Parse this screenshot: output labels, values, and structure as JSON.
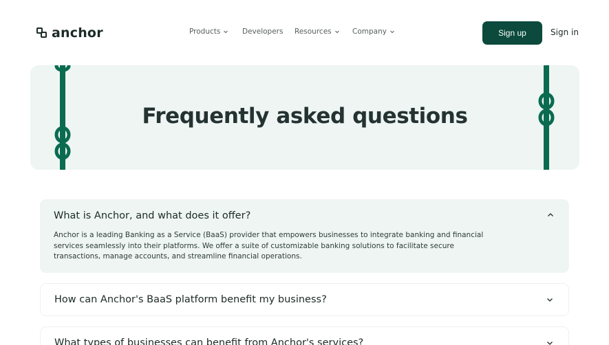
{
  "brand": {
    "name": "anchor"
  },
  "nav": {
    "items": [
      {
        "label": "Products",
        "has_dropdown": true
      },
      {
        "label": "Developers",
        "has_dropdown": false
      },
      {
        "label": "Resources",
        "has_dropdown": true
      },
      {
        "label": "Company",
        "has_dropdown": true
      }
    ],
    "signup_label": "Sign up",
    "signin_label": "Sign in"
  },
  "hero": {
    "title": "Frequently asked questions"
  },
  "faq": [
    {
      "question": "What is Anchor, and what does it offer?",
      "expanded": true,
      "answer": "Anchor is a leading Banking as a Service (BaaS) provider that empowers businesses to integrate banking and financial services seamlessly into their platforms. We offer a suite of customizable banking solutions to facilitate secure transactions, manage accounts, and streamline financial operations."
    },
    {
      "question": "How can Anchor's BaaS platform benefit my business?",
      "expanded": false
    },
    {
      "question": "What types of businesses can benefit from Anchor's services?",
      "expanded": false
    }
  ],
  "colors": {
    "brand_green": "#0b4a3c",
    "hero_background": "#eef5f3",
    "chain_green": "#0a6b50"
  }
}
